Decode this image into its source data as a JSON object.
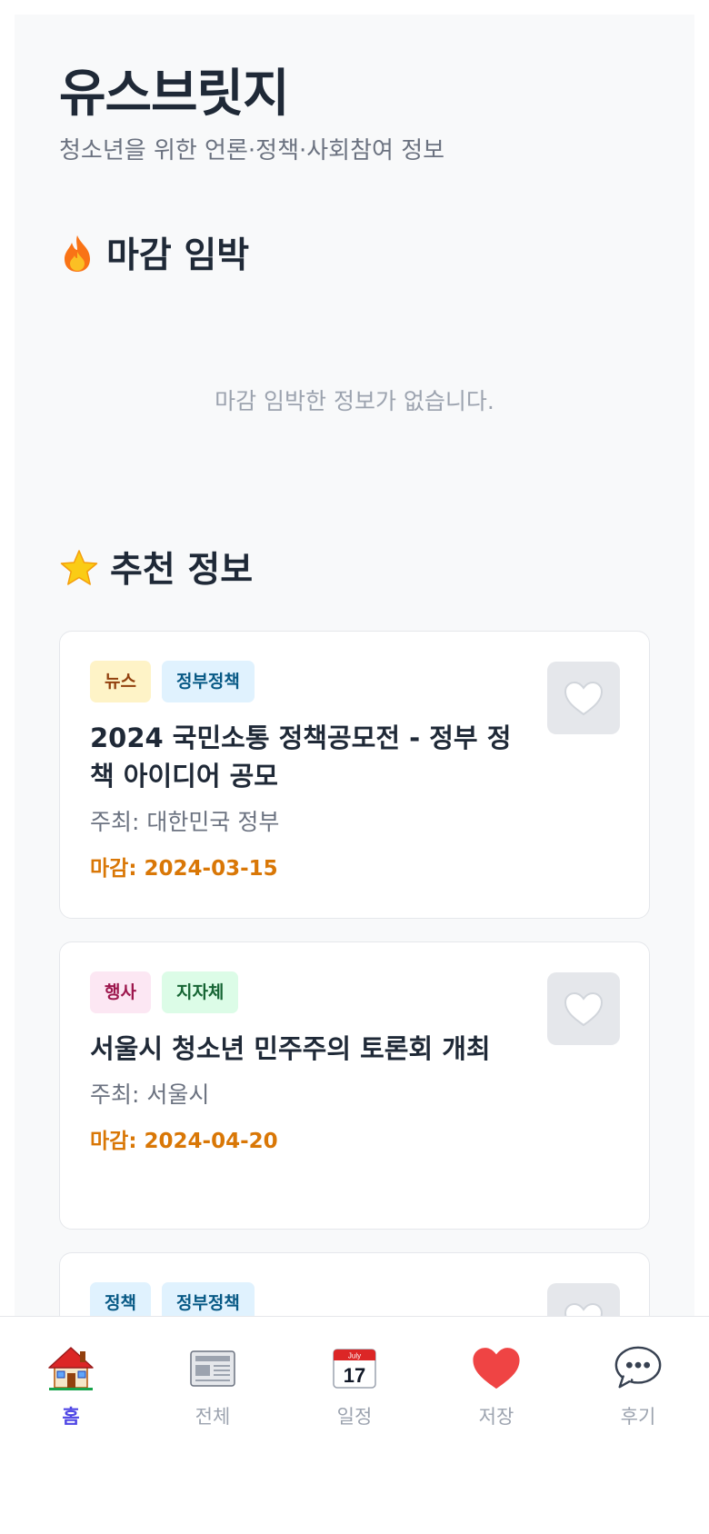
{
  "header": {
    "title": "유스브릿지",
    "subtitle": "청소년을 위한 언론·정책·사회참여 정보"
  },
  "urgent": {
    "icon": "fire-icon",
    "title": "마감 임박",
    "empty_text": "마감 임박한 정보가 없습니다."
  },
  "recommended": {
    "icon": "star-icon",
    "title": "추천 정보",
    "cards": [
      {
        "tags": [
          "뉴스",
          "정부정책"
        ],
        "title": "2024 국민소통 정책공모전 - 정부 정책 아이디어 공모",
        "host": "주최: 대한민국 정부",
        "deadline": "마감: 2024-03-15"
      },
      {
        "tags": [
          "행사",
          "지자체"
        ],
        "title": "서울시 청소년 민주주의 토론회 개최",
        "host": "주최: 서울시",
        "deadline": "마감: 2024-04-20"
      },
      {
        "tags": [
          "정책",
          "정부정책"
        ],
        "title": "",
        "host": "",
        "deadline": ""
      }
    ]
  },
  "nav": {
    "items": [
      {
        "label": "홈",
        "icon": "home-icon",
        "active": true
      },
      {
        "label": "전체",
        "icon": "newspaper-icon",
        "active": false
      },
      {
        "label": "일정",
        "icon": "calendar-icon",
        "active": false
      },
      {
        "label": "저장",
        "icon": "heart-icon",
        "active": false
      },
      {
        "label": "후기",
        "icon": "speech-bubble-icon",
        "active": false
      }
    ],
    "calendar_month": "July",
    "calendar_day": "17"
  },
  "colors": {
    "accent": "#4f46e5",
    "deadline": "#d97706",
    "heart": "#ef4444"
  }
}
